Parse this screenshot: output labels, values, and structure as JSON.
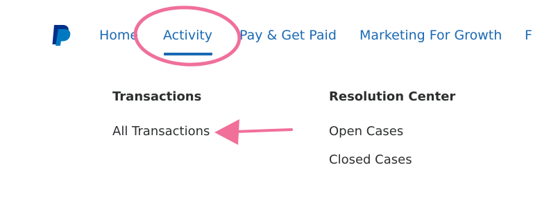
{
  "nav": {
    "items": [
      {
        "label": "Home"
      },
      {
        "label": "Activity"
      },
      {
        "label": "Pay & Get Paid"
      },
      {
        "label": "Marketing For Growth"
      },
      {
        "label": "F"
      }
    ],
    "active": "Activity",
    "accent_color": "#1a69b3"
  },
  "dropdown": {
    "columns": [
      {
        "heading": "Transactions",
        "links": [
          {
            "label": "All Transactions"
          }
        ]
      },
      {
        "heading": "Resolution Center",
        "links": [
          {
            "label": "Open Cases"
          },
          {
            "label": "Closed Cases"
          }
        ]
      }
    ]
  },
  "annotation": {
    "color": "#f0709a",
    "circle_target": "Activity",
    "arrow_target": "All Transactions"
  },
  "icons": {
    "logo": "paypal-logo-icon"
  }
}
